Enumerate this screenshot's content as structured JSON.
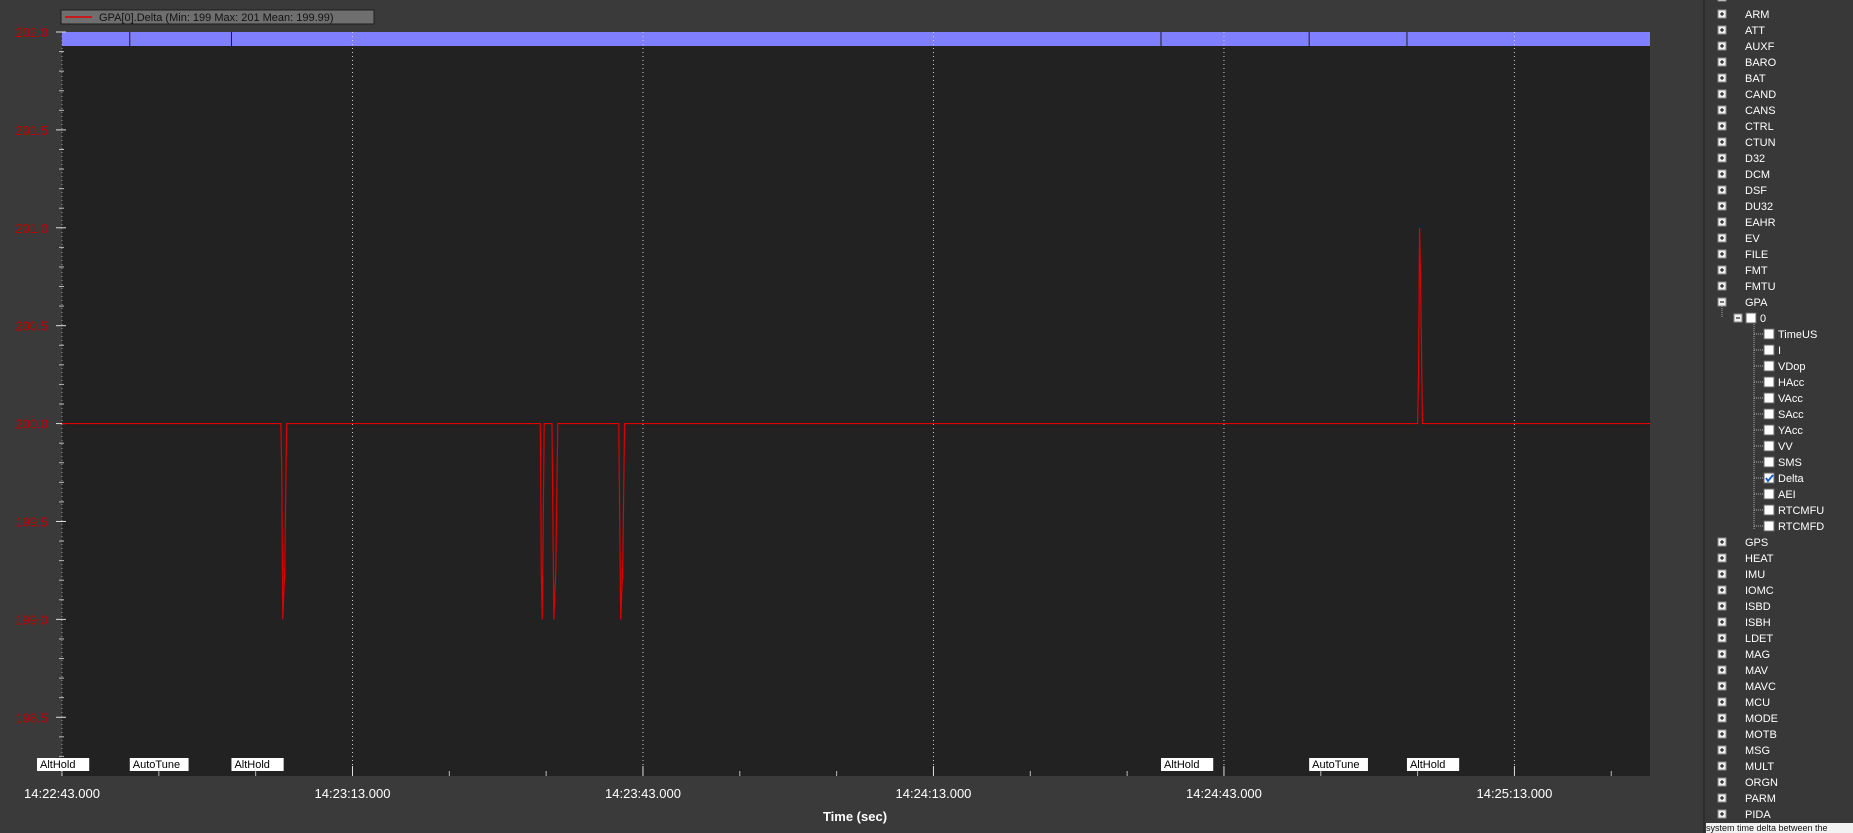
{
  "legend": {
    "label": "GPA[0].Delta  (Min: 199 Max: 201 Mean: 199.99)"
  },
  "colors": {
    "plot_bg": "#222222",
    "outer_bg": "#3a3a3a",
    "series": "#e00000",
    "mode_band": "#8080ff",
    "axis_text": "#c00000"
  },
  "chart_data": {
    "type": "line",
    "xlabel": "Time (sec)",
    "ylabel": "",
    "x_ticks": [
      "14:22:43.000",
      "14:23:13.000",
      "14:23:43.000",
      "14:24:13.000",
      "14:24:43.000",
      "14:25:13.000"
    ],
    "x_range_sec_from_first_tick": [
      0,
      164
    ],
    "y_ticks": [
      "202.0",
      "201.5",
      "201.0",
      "200.5",
      "200.0",
      "199.5",
      "199.0",
      "198.5"
    ],
    "ylim": [
      198.2,
      202.0
    ],
    "grid": "x-dotted",
    "series": [
      {
        "name": "GPA[0].Delta",
        "x": [
          0,
          22.6,
          22.7,
          22.8,
          23.0,
          23.2,
          49.4,
          49.5,
          49.6,
          49.8,
          50.6,
          50.8,
          51.0,
          51.2,
          57.5,
          57.7,
          57.9,
          58.1,
          140.0,
          140.1,
          140.2,
          140.3,
          140.5,
          164
        ],
        "y": [
          200,
          200,
          199.75,
          199,
          199.25,
          200,
          200,
          199.25,
          199,
          200,
          200,
          199,
          199.25,
          200,
          200,
          199,
          199.25,
          200,
          200,
          200.25,
          201,
          200.75,
          200,
          200
        ]
      }
    ],
    "mode_changes": [
      {
        "label": "AltHold",
        "t": 0
      },
      {
        "label": "AutoTune",
        "t": 7
      },
      {
        "label": "AltHold",
        "t": 17.5
      },
      {
        "label": "AltHold",
        "t": 113.5
      },
      {
        "label": "AutoTune",
        "t": 128.8
      },
      {
        "label": "AltHold",
        "t": 138.9
      }
    ]
  },
  "tree": {
    "items": [
      {
        "label": "ARM",
        "type": "group"
      },
      {
        "label": "ATT",
        "type": "group"
      },
      {
        "label": "AUXF",
        "type": "group"
      },
      {
        "label": "BARO",
        "type": "group"
      },
      {
        "label": "BAT",
        "type": "group"
      },
      {
        "label": "CAND",
        "type": "group"
      },
      {
        "label": "CANS",
        "type": "group"
      },
      {
        "label": "CTRL",
        "type": "group"
      },
      {
        "label": "CTUN",
        "type": "group"
      },
      {
        "label": "D32",
        "type": "group"
      },
      {
        "label": "DCM",
        "type": "group"
      },
      {
        "label": "DSF",
        "type": "group"
      },
      {
        "label": "DU32",
        "type": "group"
      },
      {
        "label": "EAHR",
        "type": "group"
      },
      {
        "label": "EV",
        "type": "group"
      },
      {
        "label": "FILE",
        "type": "group"
      },
      {
        "label": "FMT",
        "type": "group"
      },
      {
        "label": "FMTU",
        "type": "group"
      },
      {
        "label": "GPA",
        "type": "group-open"
      },
      {
        "label": "0",
        "type": "instance"
      },
      {
        "label": "TimeUS",
        "type": "field",
        "checked": false
      },
      {
        "label": "I",
        "type": "field",
        "checked": false
      },
      {
        "label": "VDop",
        "type": "field",
        "checked": false
      },
      {
        "label": "HAcc",
        "type": "field",
        "checked": false
      },
      {
        "label": "VAcc",
        "type": "field",
        "checked": false
      },
      {
        "label": "SAcc",
        "type": "field",
        "checked": false
      },
      {
        "label": "YAcc",
        "type": "field",
        "checked": false
      },
      {
        "label": "VV",
        "type": "field",
        "checked": false
      },
      {
        "label": "SMS",
        "type": "field",
        "checked": false
      },
      {
        "label": "Delta",
        "type": "field",
        "checked": true
      },
      {
        "label": "AEI",
        "type": "field",
        "checked": false
      },
      {
        "label": "RTCMFU",
        "type": "field",
        "checked": false
      },
      {
        "label": "RTCMFD",
        "type": "field",
        "checked": false
      },
      {
        "label": "GPS",
        "type": "group"
      },
      {
        "label": "HEAT",
        "type": "group"
      },
      {
        "label": "IMU",
        "type": "group"
      },
      {
        "label": "IOMC",
        "type": "group"
      },
      {
        "label": "ISBD",
        "type": "group"
      },
      {
        "label": "ISBH",
        "type": "group"
      },
      {
        "label": "LDET",
        "type": "group"
      },
      {
        "label": "MAG",
        "type": "group"
      },
      {
        "label": "MAV",
        "type": "group"
      },
      {
        "label": "MAVC",
        "type": "group"
      },
      {
        "label": "MCU",
        "type": "group"
      },
      {
        "label": "MODE",
        "type": "group"
      },
      {
        "label": "MOTB",
        "type": "group"
      },
      {
        "label": "MSG",
        "type": "group"
      },
      {
        "label": "MULT",
        "type": "group"
      },
      {
        "label": "ORGN",
        "type": "group"
      },
      {
        "label": "PARM",
        "type": "group"
      },
      {
        "label": "PIDA",
        "type": "group"
      }
    ],
    "description": "system time delta between the"
  }
}
